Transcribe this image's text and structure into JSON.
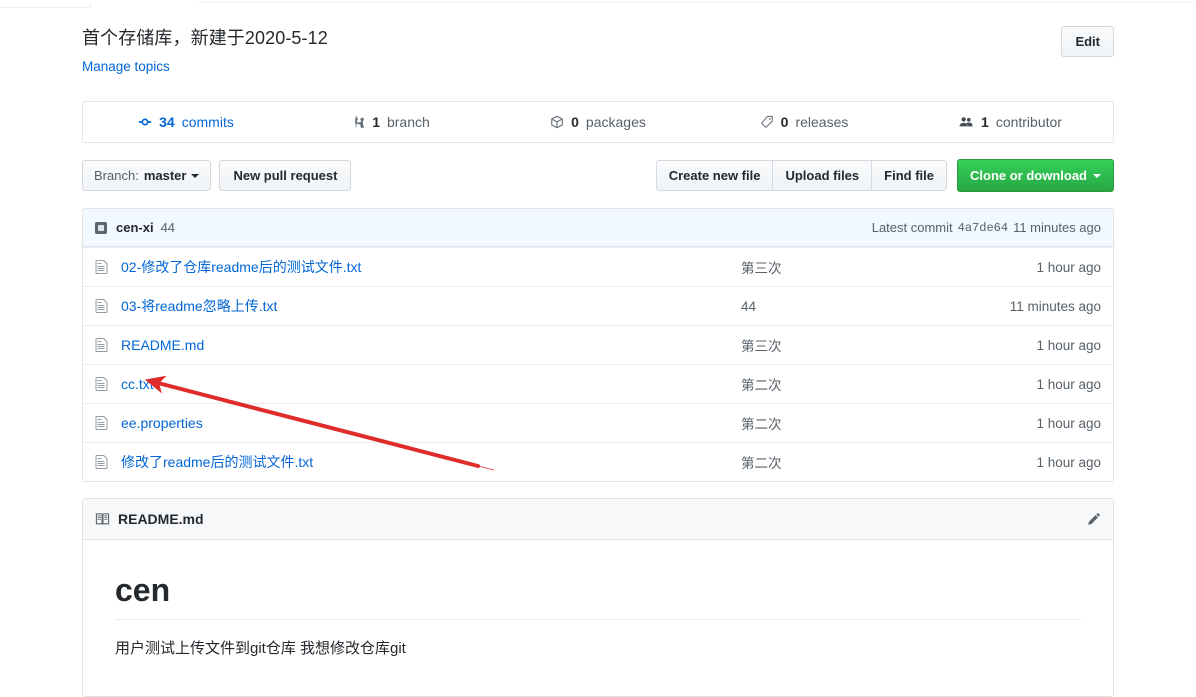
{
  "repo": {
    "description": "首个存储库，新建于2020-5-12",
    "manage_topics_label": "Manage topics",
    "edit_button_label": "Edit"
  },
  "stats": [
    {
      "count": "34",
      "label": "commits",
      "icon": "git-commit-icon",
      "is_link": true
    },
    {
      "count": "1",
      "label": "branch",
      "icon": "git-branch-icon",
      "is_link": false
    },
    {
      "count": "0",
      "label": "packages",
      "icon": "package-icon",
      "is_link": false
    },
    {
      "count": "0",
      "label": "releases",
      "icon": "tag-icon",
      "is_link": false
    },
    {
      "count": "1",
      "label": "contributor",
      "icon": "people-icon",
      "is_link": false
    }
  ],
  "toolbar": {
    "branch_prefix": "Branch:",
    "branch_name": "master",
    "new_pull_request_label": "New pull request",
    "create_new_file_label": "Create new file",
    "upload_files_label": "Upload files",
    "find_file_label": "Find file",
    "clone_or_download_label": "Clone or download"
  },
  "commit_bar": {
    "author": "cen-xi",
    "message": "44",
    "latest_commit_label": "Latest commit",
    "sha": "4a7de64",
    "age": "11 minutes ago"
  },
  "files": [
    {
      "name": "02-修改了仓库readme后的测试文件.txt",
      "message": "第三次",
      "age": "1 hour ago",
      "icon": "file-icon"
    },
    {
      "name": "03-将readme忽略上传.txt",
      "message": "44",
      "age": "11 minutes ago",
      "icon": "file-icon"
    },
    {
      "name": "README.md",
      "message": "第三次",
      "age": "1 hour ago",
      "icon": "file-icon"
    },
    {
      "name": "cc.txt",
      "message": "第二次",
      "age": "1 hour ago",
      "icon": "file-icon"
    },
    {
      "name": "ee.properties",
      "message": "第二次",
      "age": "1 hour ago",
      "icon": "file-icon"
    },
    {
      "name": "修改了readme后的测试文件.txt",
      "message": "第二次",
      "age": "1 hour ago",
      "icon": "file-icon"
    }
  ],
  "readme": {
    "title": "README.md",
    "heading": "cen",
    "paragraph": "用户测试上传文件到git仓库 我想修改仓库git"
  },
  "annotation": {
    "arrow_color": "#e02b2b",
    "points_to": "cc.txt"
  }
}
